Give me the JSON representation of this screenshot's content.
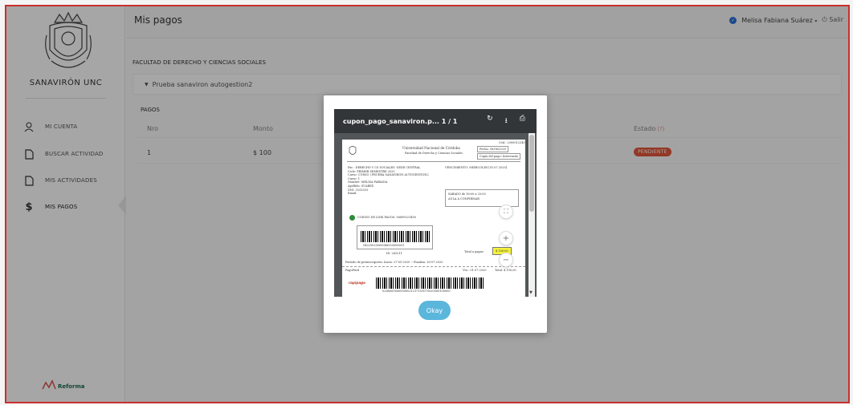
{
  "sidebar": {
    "brand": "SANAVIRÓN UNC",
    "items": [
      {
        "label": "MI CUENTA",
        "icon": "user-icon"
      },
      {
        "label": "BUSCAR ACTIVIDAD",
        "icon": "document-icon"
      },
      {
        "label": "MIS ACTIVIDADES",
        "icon": "document-icon"
      },
      {
        "label": "MIS PAGOS",
        "icon": "dollar-icon"
      }
    ],
    "footer_logo": "Reforma"
  },
  "header": {
    "title": "Mis pagos",
    "user_name": "Melisa Fabiana Suárez",
    "logout_label": "Salir"
  },
  "main": {
    "faculty": "FACULTAD DE DERECHO Y CIENCIAS SOCIALES",
    "activity": "Prueba sanaviron autogestion2",
    "section_title": "PAGOS",
    "table": {
      "headers": [
        "Nro",
        "Monto",
        "Estado"
      ],
      "rows": [
        {
          "nro": "1",
          "monto": "$ 100",
          "estado": "PENDIENTE"
        }
      ]
    }
  },
  "modal": {
    "pdf_name": "cupon_pago_sanaviron.p...",
    "page_counter": "1 / 1",
    "okay_label": "Okay",
    "doc": {
      "university": "Universidad Nacional de Córdoba",
      "faculty": "Facultad de Derecho y Ciencias Sociales",
      "date_box": "Fecha: 08/06/2020",
      "copy_box": "Copia del pago: Interesado",
      "top_code": "Cód.: 2000012345",
      "vencimiento": "VENCIMIENTO: MIERCOLES [01.07.2020]",
      "left_block": [
        "Fac.: DERECHO Y CS SOCIALES -SEDE CENTRAL",
        "Ciclo: PRIMER SEMESTRE 2020",
        "Curso: CURSO | PRUEBA SANAVIRON AUTOGESTION2",
        "Curso: 1",
        "Nombre: MELISA FABIANA",
        "Apellido: SUAREZ",
        "DNI: 3333333",
        "Email:"
      ],
      "schedule_1": "SABADO de 16:00 a 20:00",
      "schedule_2": "AULA A CONFIRMAR",
      "rapipago": "CODIGO DE LINK PAGOS: 56899521400",
      "barcode_1": "04225020000088250005851",
      "id_line": "ID: 263211",
      "total_label": "Total a pagar:",
      "total_value": "$ 100,00",
      "period": "Período de preinscripción: Inicio: 27-05-2020 -- Finaliza: 30-07-2020",
      "footer_left": "PagoFácil",
      "footer_mid": "Vto.: 01.07.2020",
      "footer_right": "Total: $ 100,00",
      "barcode_2": "02880000000000021217101070020000100000",
      "rapi_logo": "rapipago"
    }
  },
  "colors": {
    "frame_border": "#c9302c",
    "badge": "#e2573a",
    "okay": "#5bb6dc",
    "pdf_toolbar": "#323639",
    "verified": "#2a6fd6"
  }
}
